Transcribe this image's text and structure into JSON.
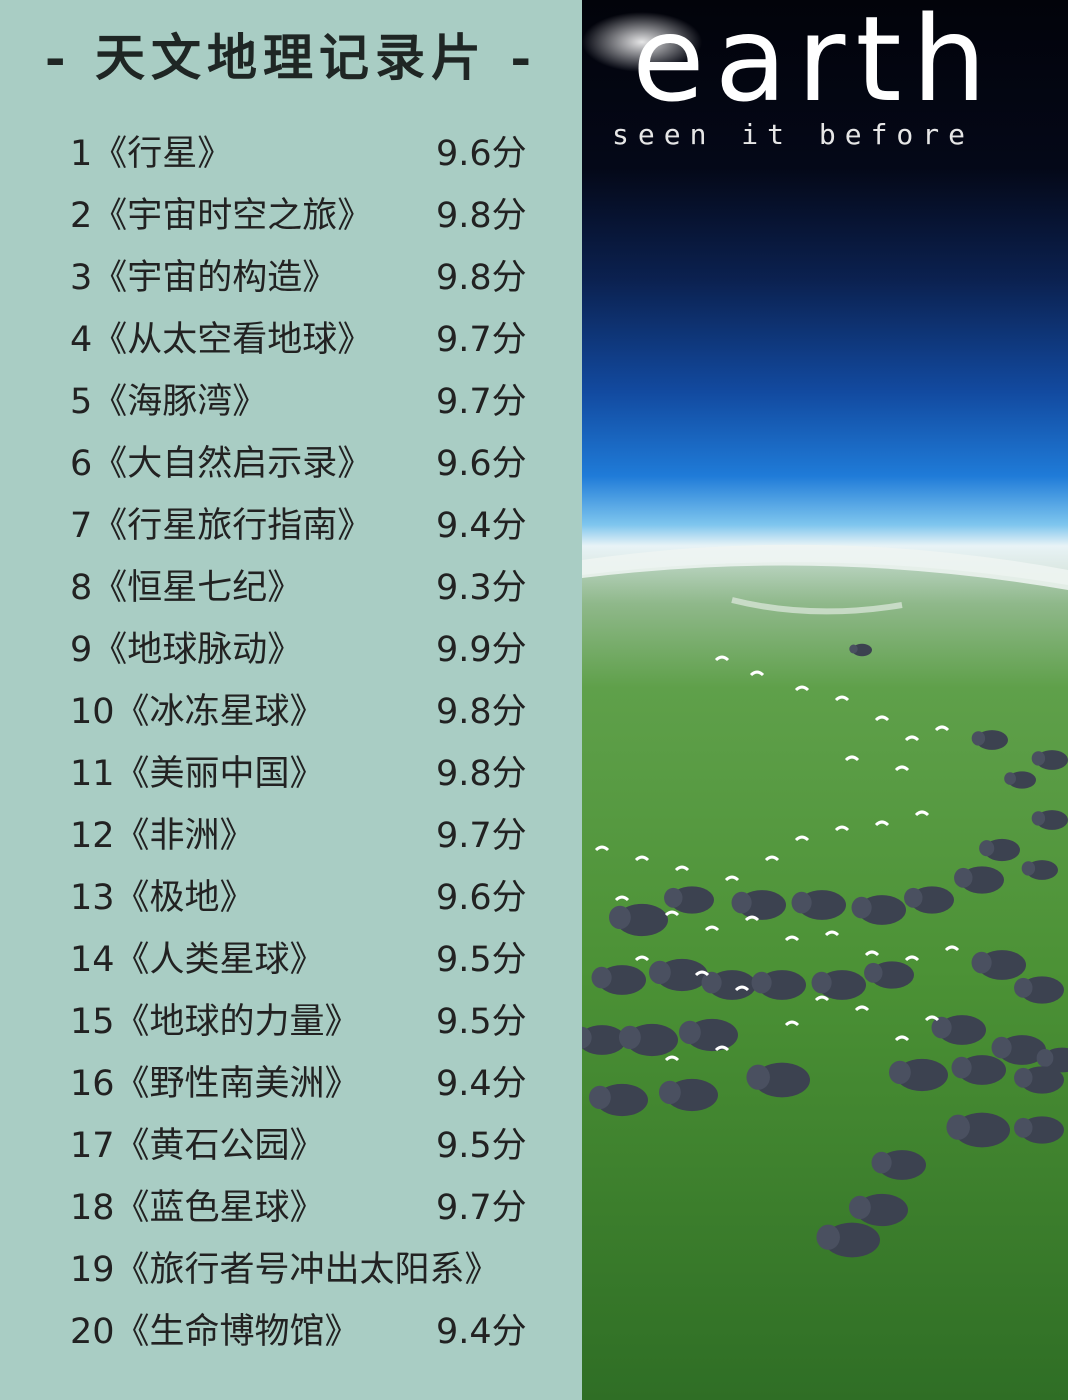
{
  "header": {
    "title": "- 天文地理记录片 -"
  },
  "poster": {
    "brand": "earth",
    "tagline": "seen it before",
    "colors": {
      "space": "#03050c",
      "atmosphere": "#1e6fd0",
      "grass": "#4f9a3a"
    }
  },
  "documentaries": [
    {
      "rank": "1",
      "name": "《行星》",
      "score": "9.6分"
    },
    {
      "rank": "2",
      "name": "《宇宙时空之旅》",
      "score": "9.8分"
    },
    {
      "rank": "3",
      "name": "《宇宙的构造》",
      "score": "9.8分"
    },
    {
      "rank": "4",
      "name": "《从太空看地球》",
      "score": "9.7分"
    },
    {
      "rank": "5",
      "name": "《海豚湾》",
      "score": "9.7分"
    },
    {
      "rank": "6",
      "name": "《大自然启示录》",
      "score": "9.6分"
    },
    {
      "rank": "7",
      "name": "《行星旅行指南》",
      "score": "9.4分"
    },
    {
      "rank": "8",
      "name": "《恒星七纪》",
      "score": "9.3分"
    },
    {
      "rank": "9",
      "name": "《地球脉动》",
      "score": "9.9分"
    },
    {
      "rank": "10",
      "name": "《冰冻星球》",
      "score": "9.8分"
    },
    {
      "rank": "11",
      "name": "《美丽中国》",
      "score": "9.8分"
    },
    {
      "rank": "12",
      "name": "《非洲》",
      "score": "9.7分"
    },
    {
      "rank": "13",
      "name": "《极地》",
      "score": "9.6分"
    },
    {
      "rank": "14",
      "name": "《人类星球》",
      "score": "9.5分"
    },
    {
      "rank": "15",
      "name": "《地球的力量》",
      "score": "9.5分"
    },
    {
      "rank": "16",
      "name": "《野性南美洲》",
      "score": "9.4分"
    },
    {
      "rank": "17",
      "name": "《黄石公园》",
      "score": "9.5分"
    },
    {
      "rank": "18",
      "name": "《蓝色星球》",
      "score": "9.7分"
    },
    {
      "rank": "19",
      "name": "《旅行者号冲出太阳系》",
      "score": ""
    },
    {
      "rank": "20",
      "name": "《生命博物馆》",
      "score": "9.4分"
    }
  ]
}
